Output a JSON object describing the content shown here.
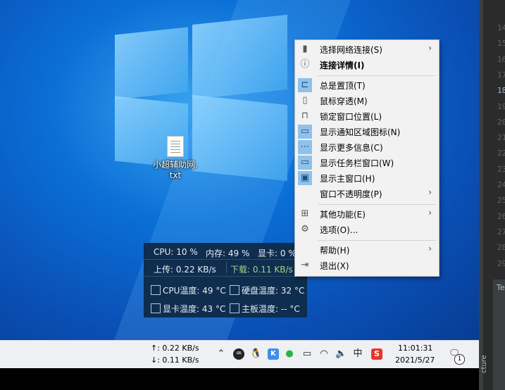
{
  "desktop": {
    "file": {
      "icon": "text-file-icon",
      "name_line1": "小超辅助网.",
      "name_line2": "txt"
    }
  },
  "menu": {
    "items": [
      {
        "label": "选择网络连接(S)",
        "icon": "signal-bars-icon",
        "checked": false,
        "submenu": true,
        "bold": false
      },
      {
        "label": "连接详情(I)",
        "icon": "info-circle-icon",
        "checked": false,
        "submenu": false,
        "bold": true
      },
      {
        "label": "总是置顶(T)",
        "icon": "pin-icon",
        "checked": true,
        "submenu": false,
        "bold": false
      },
      {
        "label": "鼠标穿透(M)",
        "icon": "mouse-icon",
        "checked": false,
        "submenu": false,
        "bold": false
      },
      {
        "label": "锁定窗口位置(L)",
        "icon": "lock-icon",
        "checked": false,
        "submenu": false,
        "bold": false
      },
      {
        "label": "显示通知区域图标(N)",
        "icon": "tray-monitor-icon",
        "checked": true,
        "submenu": false,
        "bold": false
      },
      {
        "label": "显示更多信息(C)",
        "icon": "more-dots-icon",
        "checked": true,
        "submenu": false,
        "bold": false
      },
      {
        "label": "显示任务栏窗口(W)",
        "icon": "taskbar-window-icon",
        "checked": true,
        "submenu": false,
        "bold": false
      },
      {
        "label": "显示主窗口(H)",
        "icon": "main-window-icon",
        "checked": true,
        "submenu": false,
        "bold": false
      },
      {
        "label": "窗口不透明度(P)",
        "icon": "",
        "checked": false,
        "submenu": true,
        "bold": false
      },
      {
        "label": "其他功能(E)",
        "icon": "grid-icon",
        "checked": false,
        "submenu": true,
        "bold": false
      },
      {
        "label": "选项(O)...",
        "icon": "gear-icon",
        "checked": false,
        "submenu": false,
        "bold": false
      },
      {
        "label": "帮助(H)",
        "icon": "",
        "checked": false,
        "submenu": true,
        "bold": false
      },
      {
        "label": "退出(X)",
        "icon": "exit-icon",
        "checked": false,
        "submenu": false,
        "bold": false
      }
    ]
  },
  "monitor": {
    "cpu": "CPU: 10 %",
    "memory": "内存: 49 %",
    "gpu": "显卡: 0 %",
    "upload": "上传: 0.22 KB/s",
    "download": "下载: 0.11 KB/s",
    "cpu_temp": "CPU温度: 49 °C",
    "disk_temp": "硬盘温度: 32 °C",
    "gpu_temp": "显卡温度: 43 °C",
    "board_temp": "主板温度: -- °C"
  },
  "taskbar": {
    "up_speed": "↑: 0.22 KB/s",
    "down_speed": "↓: 0.11 KB/s",
    "time": "11:01:31",
    "date": "2021/5/27",
    "notification_count": "1",
    "ime": "中",
    "tray_icons": [
      "chevron-up-icon",
      "audio-wave-icon",
      "qq-penguin-icon",
      "k-app-icon",
      "wechat-icon",
      "battery-icon",
      "wifi-icon",
      "volume-icon",
      "ime-icon",
      "sogou-s-icon"
    ]
  },
  "editor": {
    "line_numbers": [
      "14",
      "15",
      "16",
      "17",
      "18",
      "19",
      "20",
      "21",
      "22",
      "23",
      "24",
      "25",
      "26",
      "27",
      "28",
      "29"
    ],
    "panel_tab": "Te",
    "vertical_label": "cture"
  },
  "colors": {
    "menu_check": "#8fc1ea",
    "monitor_bg": "#0f2d4f",
    "download_green": "#9fd68a",
    "sogou_red": "#e8362d"
  }
}
